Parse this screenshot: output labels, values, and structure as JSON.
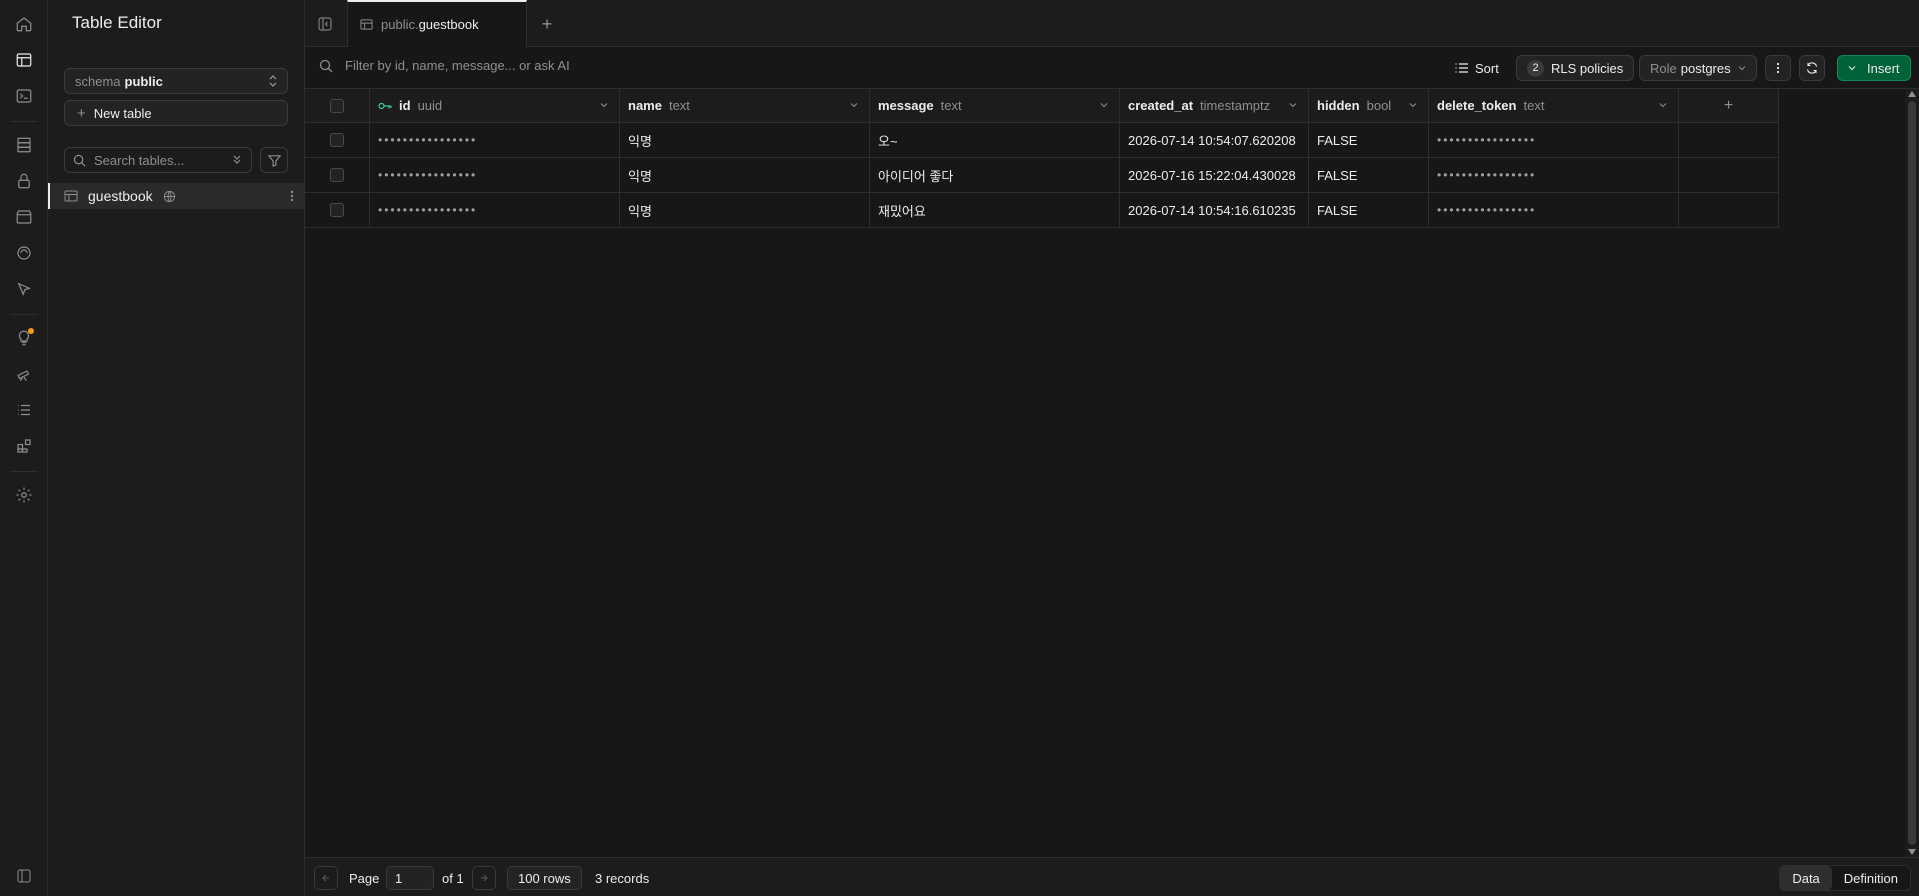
{
  "sidebar": {
    "title": "Table Editor",
    "schema_label": "schema",
    "schema_value": "public",
    "new_table": "New table",
    "search_placeholder": "Search tables...",
    "tables": [
      {
        "name": "guestbook",
        "icon": "table-icon",
        "badge_icon": "globe-icon"
      }
    ]
  },
  "tab": {
    "schema": "public.",
    "name": "guestbook"
  },
  "toolbar": {
    "filter_placeholder": "Filter by id, name, message... or ask AI",
    "sort": "Sort",
    "rls_count": "2",
    "rls": "RLS policies",
    "role_label": "Role",
    "role_value": "postgres",
    "insert": "Insert"
  },
  "columns": [
    {
      "name": "id",
      "type": "uuid",
      "key": true
    },
    {
      "name": "name",
      "type": "text"
    },
    {
      "name": "message",
      "type": "text"
    },
    {
      "name": "created_at",
      "type": "timestamptz"
    },
    {
      "name": "hidden",
      "type": "bool"
    },
    {
      "name": "delete_token",
      "type": "text"
    }
  ],
  "rows": [
    {
      "id": "••••••••••••••••",
      "name": "익명",
      "message": "오~",
      "created_at": "2026-07-14 10:54:07.620208",
      "hidden": "FALSE",
      "delete_token": "••••••••••••••••"
    },
    {
      "id": "••••••••••••••••",
      "name": "익명",
      "message": "아이디어 좋다",
      "created_at": "2026-07-16 15:22:04.430028",
      "hidden": "FALSE",
      "delete_token": "••••••••••••••••"
    },
    {
      "id": "••••••••••••••••",
      "name": "익명",
      "message": "재밌어요",
      "created_at": "2026-07-14 10:54:16.610235",
      "hidden": "FALSE",
      "delete_token": "••••••••••••••••"
    }
  ],
  "footer": {
    "page_label": "Page",
    "page_value": "1",
    "of_label": "of 1",
    "rows_label": "100 rows",
    "records": "3 records",
    "view_data": "Data",
    "view_definition": "Definition"
  },
  "colors": {
    "accent": "#3ecf8e",
    "insert_bg": "#006239",
    "notification": "#f59e0b"
  }
}
